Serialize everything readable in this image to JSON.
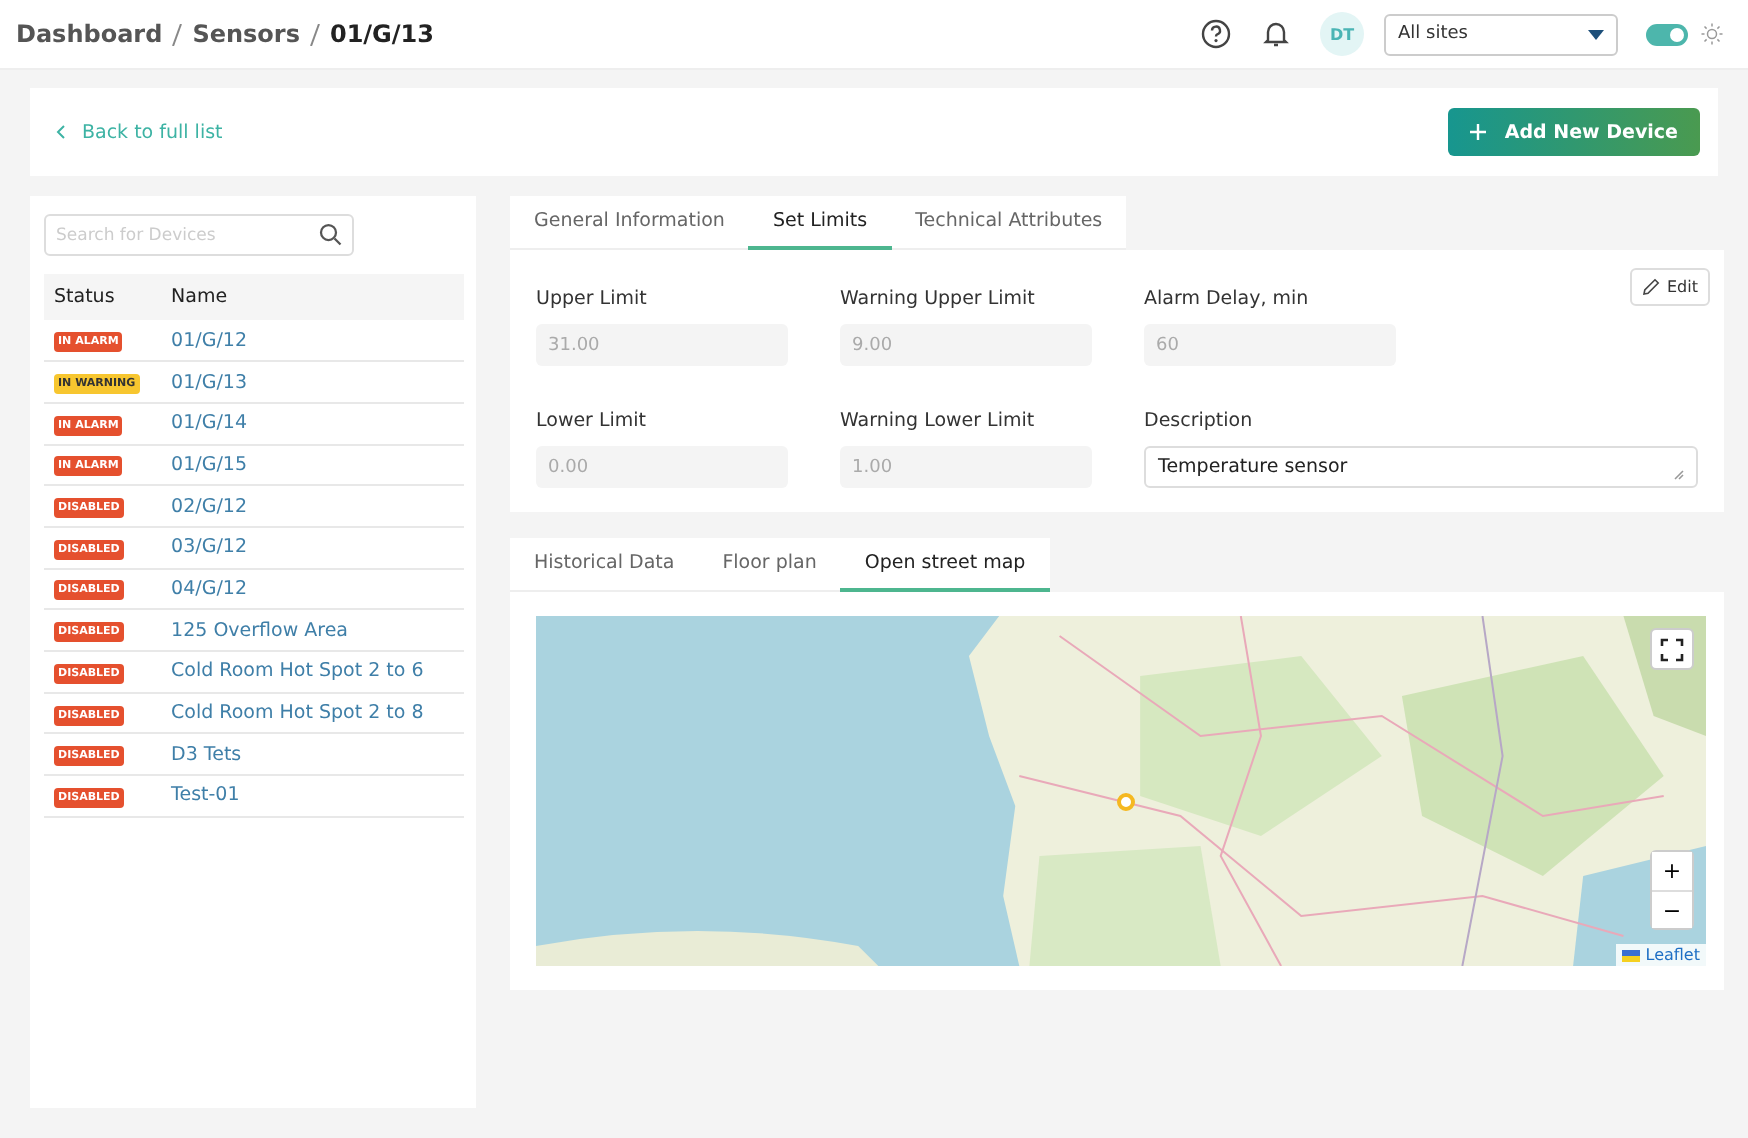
{
  "breadcrumb": [
    "Dashboard",
    "Sensors",
    "01/G/13"
  ],
  "header": {
    "avatar": "DT",
    "site_select": "All sites",
    "theme_toggle": {
      "on": true
    }
  },
  "back_link": "Back to full list",
  "add_button": "Add New Device",
  "search": {
    "placeholder": "Search for Devices"
  },
  "device_table": {
    "columns": [
      "Status",
      "Name"
    ],
    "rows": [
      {
        "status": "IN ALARM",
        "color": "#e5502e",
        "name": "01/G/12"
      },
      {
        "status": "IN WARNING",
        "color": "#f7c62f",
        "name": "01/G/13"
      },
      {
        "status": "IN ALARM",
        "color": "#e5502e",
        "name": "01/G/14"
      },
      {
        "status": "IN ALARM",
        "color": "#e5502e",
        "name": "01/G/15"
      },
      {
        "status": "DISABLED",
        "color": "#e5502e",
        "name": "02/G/12"
      },
      {
        "status": "DISABLED",
        "color": "#e5502e",
        "name": "03/G/12"
      },
      {
        "status": "DISABLED",
        "color": "#e5502e",
        "name": "04/G/12"
      },
      {
        "status": "DISABLED",
        "color": "#e5502e",
        "name": "125 Overflow Area"
      },
      {
        "status": "DISABLED",
        "color": "#e5502e",
        "name": "Cold Room Hot Spot 2 to 6"
      },
      {
        "status": "DISABLED",
        "color": "#e5502e",
        "name": "Cold Room Hot Spot 2 to 8"
      },
      {
        "status": "DISABLED",
        "color": "#e5502e",
        "name": "D3 Tets"
      },
      {
        "status": "DISABLED",
        "color": "#e5502e",
        "name": "Test-01"
      }
    ]
  },
  "detail_tabs": [
    {
      "label": "General Information",
      "selected": false
    },
    {
      "label": "Set Limits",
      "selected": true
    },
    {
      "label": "Technical Attributes",
      "selected": false
    }
  ],
  "edit_button": "Edit",
  "limits": [
    {
      "label": "Upper Limit",
      "value": "31.00",
      "kind": "readonly"
    },
    {
      "label": "Warning Upper Limit",
      "value": "9.00",
      "kind": "readonly"
    },
    {
      "label": "Alarm Delay, min",
      "value": "60",
      "kind": "readonly"
    },
    {
      "label": "Lower Limit",
      "value": "0.00",
      "kind": "readonly"
    },
    {
      "label": "Warning Lower Limit",
      "value": "1.00",
      "kind": "readonly"
    },
    {
      "label": "Description",
      "value": "Temperature sensor",
      "kind": "textarea"
    }
  ],
  "data_tabs": [
    {
      "label": "Historical Data",
      "selected": false
    },
    {
      "label": "Floor plan",
      "selected": false
    },
    {
      "label": "Open street map",
      "selected": true
    }
  ],
  "map": {
    "kind": "picture",
    "zoom_in": "+",
    "zoom_out": "−",
    "attribution": "Leaflet"
  }
}
